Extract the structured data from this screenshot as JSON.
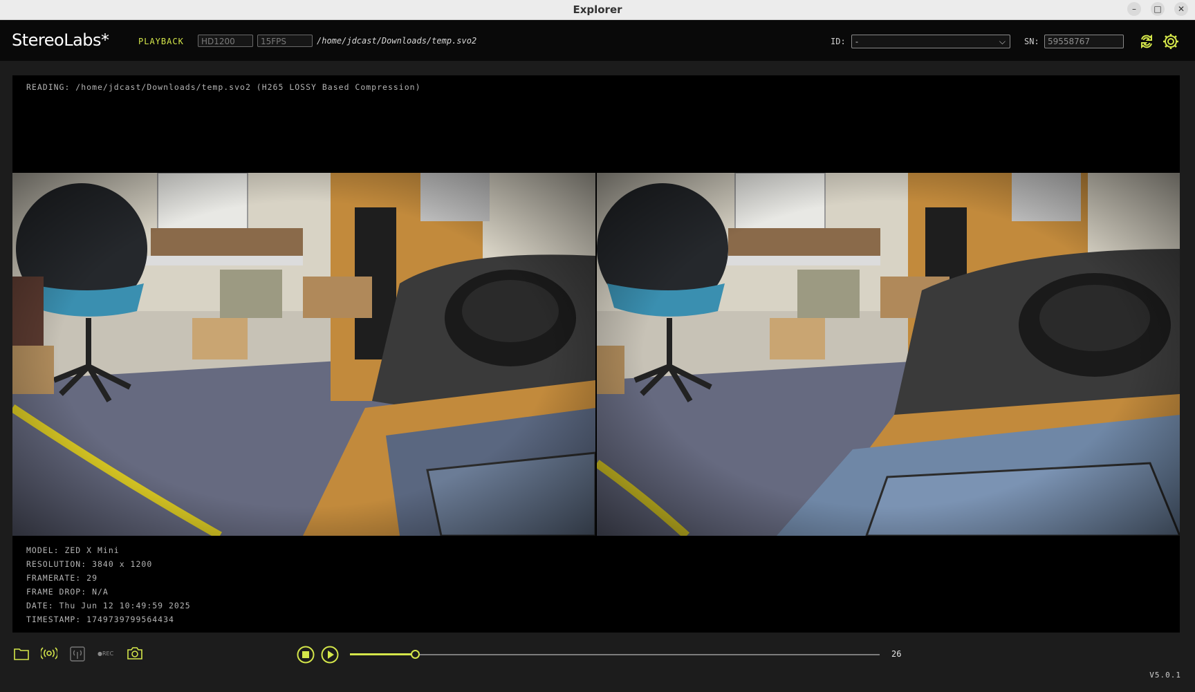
{
  "window": {
    "title": "Explorer",
    "minimize": "–",
    "maximize": "□",
    "close": "✕"
  },
  "header": {
    "brand": "StereoLabs*",
    "mode": "PLAYBACK",
    "resolution": "HD1200",
    "fps": "15FPS",
    "file_path": "/home/jdcast/Downloads/temp.svo2",
    "id_label": "ID:",
    "id_value": "-",
    "sn_label": "SN:",
    "sn_value": "59558767"
  },
  "viewer": {
    "reading": "READING: /home/jdcast/Downloads/temp.svo2 (H265 LOSSY Based Compression)",
    "info": {
      "model": "MODEL: ZED X Mini",
      "resolution": "RESOLUTION: 3840 x 1200",
      "framerate": "FRAMERATE: 29",
      "frame_drop": "FRAME DROP: N/A",
      "date": "DATE: Thu Jun 12 10:49:59 2025",
      "timestamp": "TIMESTAMP: 1749739799564434"
    }
  },
  "playback": {
    "rec_label": "●REC",
    "progress": 0.123,
    "frame": "26"
  },
  "version": "V5.0.1",
  "colors": {
    "accent": "#d4e64a",
    "background": "#1c1c1c"
  },
  "icons": [
    "folder-icon",
    "stream-icon",
    "network-stream-icon",
    "record-icon",
    "camera-icon",
    "stop-icon",
    "play-icon",
    "sync-icon",
    "gear-icon"
  ]
}
